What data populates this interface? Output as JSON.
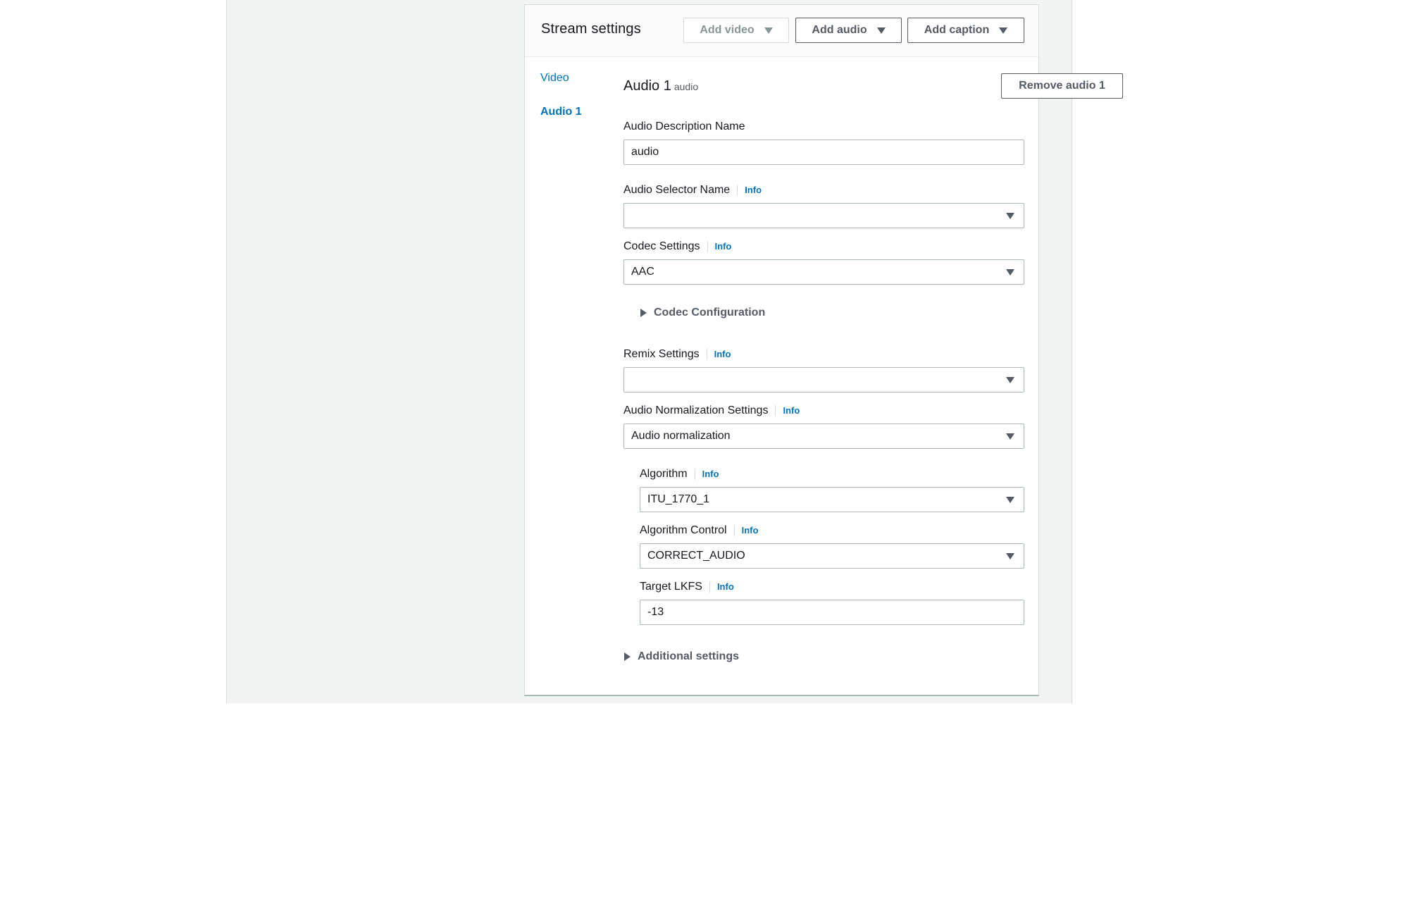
{
  "header": {
    "title": "Stream settings",
    "add_video_label": "Add video",
    "add_audio_label": "Add audio",
    "add_caption_label": "Add caption"
  },
  "nav": {
    "items": [
      {
        "label": "Video",
        "active": false
      },
      {
        "label": "Audio 1",
        "active": true
      }
    ]
  },
  "section": {
    "title": "Audio 1",
    "subtitle": "audio",
    "remove_label": "Remove audio 1"
  },
  "fields": {
    "audio_description_name": {
      "label": "Audio Description Name",
      "value": "audio"
    },
    "audio_selector_name": {
      "label": "Audio Selector Name",
      "info": "Info",
      "value": ""
    },
    "codec_settings": {
      "label": "Codec Settings",
      "info": "Info",
      "value": "AAC"
    },
    "codec_configuration": {
      "label": "Codec Configuration"
    },
    "remix_settings": {
      "label": "Remix Settings",
      "info": "Info",
      "value": ""
    },
    "audio_normalization_settings": {
      "label": "Audio Normalization Settings",
      "info": "Info",
      "value": "Audio normalization"
    },
    "algorithm": {
      "label": "Algorithm",
      "info": "Info",
      "value": "ITU_1770_1"
    },
    "algorithm_control": {
      "label": "Algorithm Control",
      "info": "Info",
      "value": "CORRECT_AUDIO"
    },
    "target_lkfs": {
      "label": "Target LKFS",
      "info": "Info",
      "value": "-13"
    },
    "additional_settings": {
      "label": "Additional settings"
    }
  },
  "colors": {
    "link_blue": "#0073bb",
    "text_dark": "#16191f",
    "text_grey": "#545b64",
    "page_bg": "#f2f3f3"
  }
}
